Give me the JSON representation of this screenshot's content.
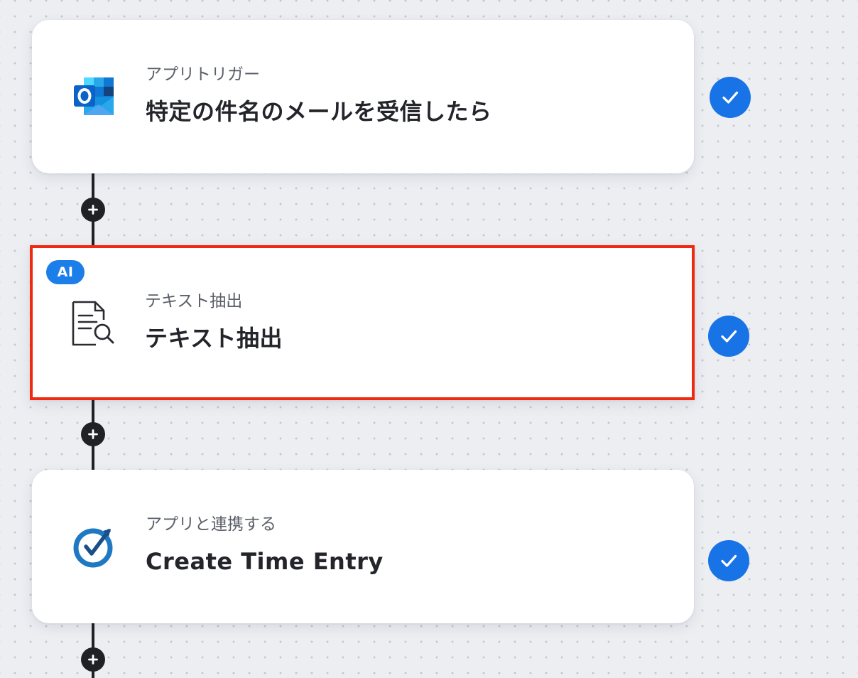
{
  "workflow": {
    "steps": [
      {
        "category": "アプリトリガー",
        "title": "特定の件名のメールを受信したら",
        "icon": "outlook-icon",
        "status": "completed"
      },
      {
        "badge": "AI",
        "category": "テキスト抽出",
        "title": "テキスト抽出",
        "icon": "document-search-icon",
        "status": "completed",
        "selected": true
      },
      {
        "category": "アプリと連携する",
        "title": "Create Time Entry",
        "icon": "clockify-icon",
        "status": "completed"
      }
    ],
    "add_step_icon": "plus-icon",
    "status_icon": "check-icon"
  },
  "colors": {
    "accent": "#1873e6",
    "ai_badge": "#1c7ee8",
    "selection_border": "#ef2a10",
    "connector": "#1f2125",
    "outlook_blue": "#0a64c8",
    "clockify_blue": "#1f78c1"
  }
}
